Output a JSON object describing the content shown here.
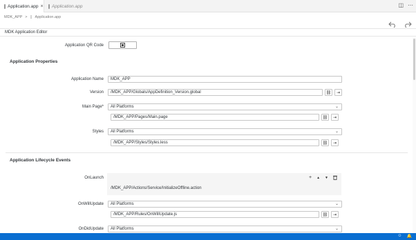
{
  "tabs": [
    {
      "label": "Application.app",
      "active": true
    },
    {
      "label": "Application.app",
      "active": false
    }
  ],
  "breadcrumb": {
    "root": "MDK_APP",
    "separator": ">",
    "file": "Application.app"
  },
  "editor": {
    "title": "MDK Application Editor"
  },
  "qr": {
    "label": "Application QR Code"
  },
  "sections": {
    "properties": "Application Properties",
    "lifecycle": "Application Lifecycle Events"
  },
  "fields": {
    "name": {
      "label": "Application Name",
      "value": "MDK_APP"
    },
    "version": {
      "label": "Version",
      "value": "/MDK_APP/Globals/AppDefinition_Version.global"
    },
    "main_page": {
      "label": "Main Page*",
      "platform": "All Platforms",
      "value": "/MDK_APP/Pages/Main.page"
    },
    "styles": {
      "label": "Styles",
      "platform": "All Platforms",
      "value": "/MDK_APP/Styles/Styles.less"
    },
    "on_launch": {
      "label": "OnLaunch",
      "value": "/MDK_APP/Actions/Service/InitializeOffline.action"
    },
    "on_will_update": {
      "label": "OnWillUpdate",
      "platform": "All Platforms",
      "value": "/MDK_APP/Rules/OnWillUpdate.js"
    },
    "on_did_update": {
      "label": "OnDidUpdate",
      "platform": "All Platforms"
    }
  },
  "icons": {
    "add": "+",
    "up": "▲",
    "down": "▼",
    "delete": "🗑",
    "chevron": "⌄"
  },
  "colors": {
    "statusbar": "#0a6ed1"
  }
}
